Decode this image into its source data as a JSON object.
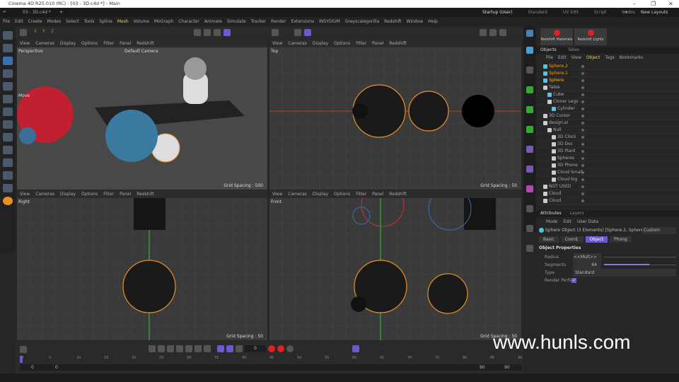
{
  "window": {
    "title": "Cinema 4D R25.010 (RC) - [03 - 3D.c4d *] - Main",
    "document_tab": "03 - 3D.c4d *"
  },
  "layouts": {
    "tabs": [
      "Startup (User)",
      "Standard",
      "UV Edit",
      "Script",
      "Nodes"
    ],
    "active": "Startup (User)",
    "new_layouts": "New Layouts"
  },
  "menu": [
    "File",
    "Edit",
    "Create",
    "Modes",
    "Select",
    "Tools",
    "Spline",
    "Mesh",
    "Volume",
    "MoGraph",
    "Character",
    "Animate",
    "Simulate",
    "Tracker",
    "Render",
    "Extensions",
    "INSYDIUM",
    "Greyscalegorilla",
    "Redshift",
    "Window",
    "Help"
  ],
  "axes": [
    "X",
    "Y",
    "Z"
  ],
  "redshift": {
    "materials": "Redshift Materials",
    "lights": "Redshift Lights"
  },
  "viewport_menu": [
    "View",
    "Cameras",
    "Display",
    "Options",
    "Filter",
    "Panel",
    "Redshift"
  ],
  "viewports": [
    {
      "name": "Perspective",
      "camera": "Default Camera",
      "grid": "Grid Spacing : 500",
      "tool": "Move"
    },
    {
      "name": "Top",
      "grid": "Grid Spacing : 50"
    },
    {
      "name": "Right",
      "grid": "Grid Spacing : 50"
    },
    {
      "name": "Front",
      "grid": "Grid Spacing : 50"
    }
  ],
  "objects_panel": {
    "tabs": [
      "Objects",
      "Takes"
    ],
    "menu": [
      "File",
      "Edit",
      "View",
      "Object",
      "Tags",
      "Bookmarks"
    ],
    "items": [
      {
        "name": "Sphere.2",
        "level": 0,
        "color": "#e8a040"
      },
      {
        "name": "Sphere.1",
        "level": 0,
        "color": "#e8a040"
      },
      {
        "name": "Sphere",
        "level": 0,
        "color": "#e8c040"
      },
      {
        "name": "Table",
        "level": 0,
        "color": "#aaaaaa"
      },
      {
        "name": "Cube",
        "level": 1,
        "color": "#aaaaaa"
      },
      {
        "name": "Cloner Legs",
        "level": 1,
        "color": "#aaaaaa"
      },
      {
        "name": "Cylinder",
        "level": 2,
        "color": "#aaaaaa"
      },
      {
        "name": "3D Cursor",
        "level": 0,
        "color": "#aaaaaa"
      },
      {
        "name": "design.ai",
        "level": 0,
        "color": "#aaaaaa"
      },
      {
        "name": "Null",
        "level": 1,
        "color": "#aaaaaa"
      },
      {
        "name": "3D Clock",
        "level": 2,
        "color": "#aaaaaa"
      },
      {
        "name": "3D Doc",
        "level": 2,
        "color": "#aaaaaa"
      },
      {
        "name": "3D Plant",
        "level": 2,
        "color": "#aaaaaa"
      },
      {
        "name": "Spheres",
        "level": 2,
        "color": "#aaaaaa"
      },
      {
        "name": "3D Phone",
        "level": 2,
        "color": "#aaaaaa"
      },
      {
        "name": "Cloud Small",
        "level": 2,
        "color": "#aaaaaa"
      },
      {
        "name": "Cloud big",
        "level": 2,
        "color": "#aaaaaa"
      },
      {
        "name": "NOT USED",
        "level": 0,
        "color": "#aaaaaa"
      },
      {
        "name": "Cloud",
        "level": 0,
        "color": "#aaaaaa"
      },
      {
        "name": "Cloud",
        "level": 0,
        "color": "#aaaaaa"
      }
    ]
  },
  "attributes": {
    "tabs": [
      "Attributes",
      "Layers"
    ],
    "menu": [
      "Mode",
      "Edit",
      "User Data"
    ],
    "object_line": "Sphere Object (3 Elements) [Sphere.2, Sphere.1, Sphere]",
    "preset": "Custom",
    "subtabs": [
      "Basic",
      "Coord.",
      "Object",
      "Phong"
    ],
    "active_subtab": "Object",
    "section": "Object Properties",
    "fields": [
      {
        "label": "Radius",
        "value": "<<Mult>>"
      },
      {
        "label": "Segments",
        "value": "64",
        "fill": 0.63
      },
      {
        "label": "Type",
        "value": "Standard"
      },
      {
        "label": "Render Perfect",
        "value": "checked"
      }
    ]
  },
  "timeline": {
    "frame": "0",
    "ticks": [
      "0",
      "5",
      "10",
      "15",
      "20",
      "25",
      "30",
      "35",
      "40",
      "45",
      "50",
      "55",
      "60",
      "65",
      "70",
      "75",
      "80",
      "85",
      "90"
    ],
    "start": "0",
    "range_start": "0",
    "range_end": "90",
    "end": "90"
  },
  "watermark": "www.hunls.com",
  "colors": {
    "accent": "#6a5acd",
    "orange": "#e8a040",
    "red": "#d22a2a"
  }
}
